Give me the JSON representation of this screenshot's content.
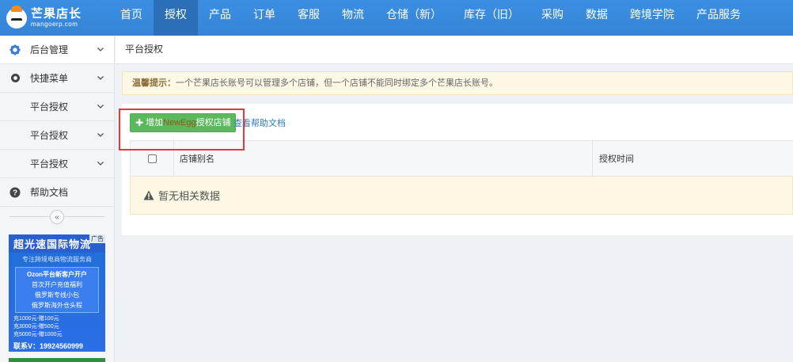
{
  "logo": {
    "name": "芒果店长",
    "domain": "mangoerp.com"
  },
  "nav": {
    "items": [
      {
        "label": "首页",
        "active": false
      },
      {
        "label": "授权",
        "active": true
      },
      {
        "label": "产品",
        "active": false
      },
      {
        "label": "订单",
        "active": false
      },
      {
        "label": "客服",
        "active": false
      },
      {
        "label": "物流",
        "active": false
      },
      {
        "label": "仓储（新）",
        "active": false
      },
      {
        "label": "库存（旧）",
        "active": false
      },
      {
        "label": "采购",
        "active": false
      },
      {
        "label": "数据",
        "active": false
      },
      {
        "label": "跨境学院",
        "active": false
      },
      {
        "label": "产品服务",
        "active": false
      }
    ]
  },
  "sidebar": {
    "items": [
      {
        "label": "后台管理",
        "icon": "gear-icon"
      },
      {
        "label": "快捷菜单",
        "icon": "target-icon"
      },
      {
        "label": "平台授权"
      },
      {
        "label": "平台授权"
      },
      {
        "label": "平台授权"
      },
      {
        "label": "帮助文档",
        "icon": "question-icon"
      }
    ],
    "collapse_glyph": "«"
  },
  "ad": {
    "title": "超光速国际物流",
    "label": "广告",
    "subtitle": "专注跨境电商物流服务商",
    "lines": [
      "Ozon平台新客户开户",
      "首次开户充值福利",
      "俄罗斯专线小包",
      "俄罗斯海外仓头程"
    ],
    "prices": [
      "充1000元-赠100元",
      "充3000元-赠500元",
      "充5000元-赠1000元"
    ],
    "contact": "联系V：19924560999"
  },
  "main": {
    "breadcrumb": "平台授权",
    "tip": {
      "label": "温馨提示：",
      "text": "一个芒果店长账号可以管理多个店铺，但一个店铺不能同时绑定多个芒果店长账号。"
    },
    "add_button": {
      "prefix": "增加",
      "brand": "NewEgg",
      "suffix": "授权店铺"
    },
    "help_link": "查看帮助文档",
    "table": {
      "columns": [
        "店铺别名",
        "授权时间"
      ],
      "empty_text": "暂无相关数据"
    }
  },
  "colors": {
    "nav": "#3a8ee6",
    "nav_active": "#2a6fb8",
    "add_button": "#5cb85c",
    "highlight": "#e0393e",
    "tip_bg": "#fcf8e3"
  }
}
